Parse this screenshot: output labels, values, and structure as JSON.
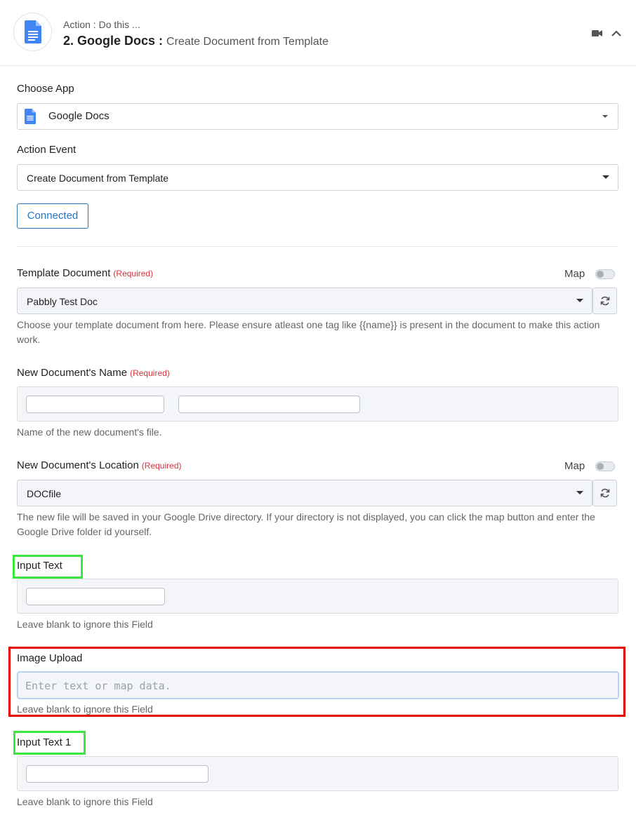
{
  "header": {
    "subtitle": "Action : Do this ...",
    "title": "2. Google Docs :",
    "event": "Create Document from Template"
  },
  "choose_app": {
    "label": "Choose App",
    "value": "Google Docs"
  },
  "action_event": {
    "label": "Action Event",
    "value": "Create Document from Template"
  },
  "connected_label": "Connected",
  "required_text": "(Required)",
  "map_label": "Map",
  "template_document": {
    "label": "Template Document",
    "value": "Pabbly Test Doc",
    "help": "Choose your template document from here. Please ensure atleast one tag like {{name}} is present in the document to make this action work."
  },
  "new_doc_name": {
    "label": "New Document's Name",
    "separator": "-",
    "help": "Name of the new document's file."
  },
  "new_doc_location": {
    "label": "New Document's Location",
    "value": "DOCfile",
    "help": "The new file will be saved in your Google Drive directory. If your directory is not displayed, you can click the map button and enter the Google Drive folder id yourself."
  },
  "input_text": {
    "label": "Input Text",
    "help": "Leave blank to ignore this Field"
  },
  "image_upload": {
    "label": "Image Upload",
    "placeholder": "Enter text or map data.",
    "help": "Leave blank to ignore this Field"
  },
  "input_text_1": {
    "label": "Input Text 1",
    "help": "Leave blank to ignore this Field"
  },
  "colors": {
    "accent": "#2774c3",
    "required": "#d1363b",
    "green_highlight": "#39e83a",
    "red_highlight": "#e50000"
  }
}
